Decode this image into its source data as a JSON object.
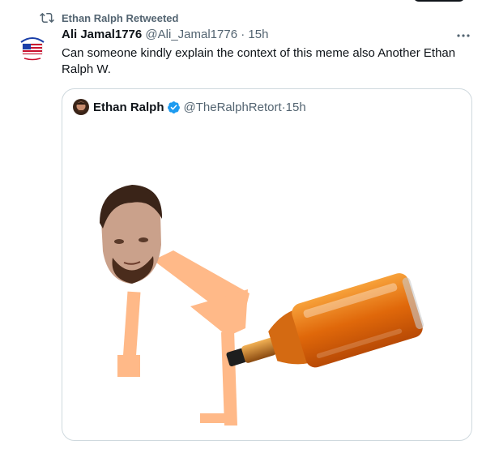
{
  "retweet": {
    "icon": "retweet-icon",
    "label": "Ethan Ralph Retweeted"
  },
  "tweet": {
    "name": "Ali Jamal1776",
    "handle": "@Ali_Jamal1776",
    "separator": "·",
    "time": "15h",
    "text": "Can someone kindly explain the context of this meme also Another Ethan Ralph W.",
    "more_icon": "more-options-icon"
  },
  "quote": {
    "name": "Ethan Ralph",
    "verified_icon": "verified-badge-icon",
    "handle": "@TheRalphRetort",
    "separator": "·",
    "time": "15h"
  },
  "colors": {
    "verified": "#1d9bf0",
    "secondary_text": "#536471",
    "border": "#cfd9de",
    "figure_body": "#ffb988",
    "bottle": "#e8720c"
  }
}
